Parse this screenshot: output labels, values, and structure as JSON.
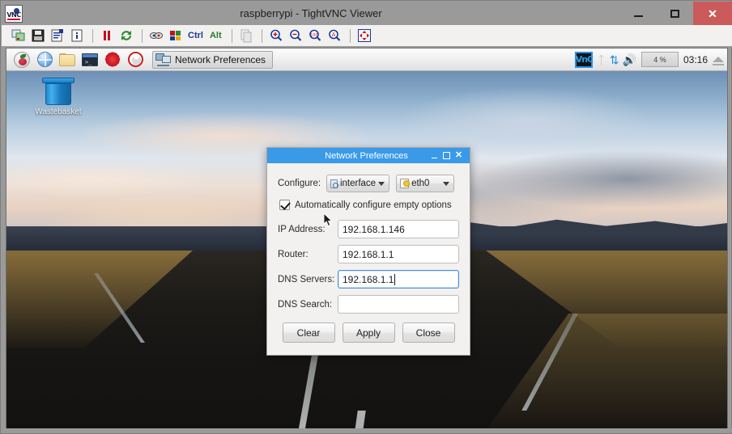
{
  "viewer_window": {
    "title": "raspberrypi - TightVNC Viewer",
    "logo_text": "VNC",
    "controls": {
      "minimize": "minimize-button",
      "maximize": "maximize-button",
      "close": "✕"
    },
    "toolbar": {
      "items": [
        {
          "name": "new-connection-icon",
          "title": "New connection"
        },
        {
          "name": "save-session-icon",
          "title": "Save session"
        },
        {
          "name": "connection-options-icon",
          "title": "Connection options"
        },
        {
          "name": "connection-info-icon",
          "title": "Connection info"
        },
        {
          "name": "pause-icon",
          "title": "Pause updates"
        },
        {
          "name": "refresh-icon",
          "title": "Request screen refresh"
        },
        {
          "name": "send-keys-icon",
          "title": "Send keys"
        },
        {
          "name": "send-ctrl-alt-del-icon",
          "title": "Send Ctrl-Alt-Del"
        },
        {
          "name": "ctrl-key-toggle",
          "label": "Ctrl"
        },
        {
          "name": "alt-key-toggle",
          "label": "Alt"
        },
        {
          "name": "transfer-files-icon",
          "title": "Transfer files"
        },
        {
          "name": "zoom-in-icon",
          "title": "Zoom in"
        },
        {
          "name": "zoom-out-icon",
          "title": "Zoom out"
        },
        {
          "name": "zoom-100-icon",
          "label": "100"
        },
        {
          "name": "zoom-auto-icon",
          "label": "A"
        },
        {
          "name": "fullscreen-icon",
          "title": "Full screen"
        }
      ]
    }
  },
  "desktop": {
    "icons": [
      {
        "name": "wastebasket-icon",
        "label": "Wastebasket"
      }
    ]
  },
  "taskbar": {
    "launchers": [
      {
        "name": "raspberry-menu-icon",
        "label": "Menu"
      },
      {
        "name": "web-browser-icon",
        "label": "Web Browser"
      },
      {
        "name": "file-manager-icon",
        "label": "File Manager"
      },
      {
        "name": "terminal-icon",
        "label": "Terminal"
      },
      {
        "name": "mathematica-icon",
        "label": "Mathematica"
      },
      {
        "name": "wolfram-icon",
        "label": "Wolfram"
      }
    ],
    "task_buttons": [
      {
        "name": "taskbar-item-network-preferences",
        "label": "Network Preferences",
        "icon": "network-preferences-icon"
      }
    ],
    "tray": {
      "vnc_label": "VnC",
      "bluetooth_icon": "bluetooth-icon",
      "network_icon": "network-updown-icon",
      "volume_icon": "volume-icon",
      "cpu_usage": "4 %",
      "clock": "03:16",
      "eject_icon": "eject-icon"
    }
  },
  "dialog": {
    "title": "Network Preferences",
    "controls": {
      "minimize": "minimize",
      "maximize": "maximize",
      "close": "✕"
    },
    "configure_label": "Configure:",
    "configure_type": {
      "value": "interface",
      "icon": "interface-icon"
    },
    "configure_target": {
      "value": "eth0",
      "icon": "device-icon"
    },
    "auto_configure": {
      "label": "Automatically configure empty options",
      "checked": true
    },
    "fields": [
      {
        "name": "ip-address",
        "label": "IP Address:",
        "value": "192.168.1.146",
        "focused": false
      },
      {
        "name": "router",
        "label": "Router:",
        "value": "192.168.1.1",
        "focused": false
      },
      {
        "name": "dns-servers",
        "label": "DNS Servers:",
        "value": "192.168.1.1",
        "focused": true
      },
      {
        "name": "dns-search",
        "label": "DNS Search:",
        "value": "",
        "focused": false
      }
    ],
    "buttons": [
      {
        "name": "clear-button",
        "label": "Clear"
      },
      {
        "name": "apply-button",
        "label": "Apply"
      },
      {
        "name": "close-button",
        "label": "Close"
      }
    ]
  },
  "colors": {
    "dialog_titlebar": "#3a9ae8",
    "window_close": "#cb5a5a",
    "tray_accent": "#1e8fe0",
    "focus_border": "#4a90d9"
  }
}
